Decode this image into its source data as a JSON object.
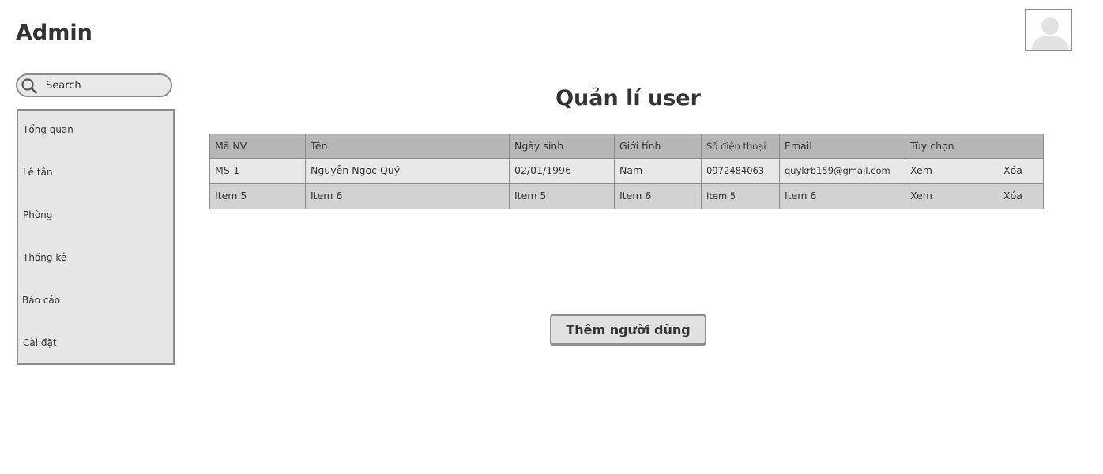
{
  "app": {
    "title": "Admin"
  },
  "search": {
    "placeholder": "Search"
  },
  "sidebar": {
    "items": [
      {
        "label": "Tổng quan"
      },
      {
        "label": "Lễ tân"
      },
      {
        "label": "Phòng"
      },
      {
        "label": "Thống kê"
      },
      {
        "label": "Báo cáo"
      },
      {
        "label": "Cài đặt"
      }
    ]
  },
  "page": {
    "title": "Quản lí user"
  },
  "table": {
    "headers": [
      "Mã NV",
      "Tên",
      "Ngày sinh",
      "Giới tính",
      "Số điện thoại",
      "Email",
      "Tùy chọn"
    ],
    "rows": [
      {
        "ma_nv": "MS-1",
        "ten": "Nguyễn Ngọc Quý",
        "ngay_sinh": "02/01/1996",
        "gioi_tinh": "Nam",
        "so_dien_thoai": "0972484063",
        "email": "quykrb159@gmail.com",
        "view": "Xem",
        "delete": "Xóa"
      },
      {
        "ma_nv": "Item 5",
        "ten": "Item 6",
        "ngay_sinh": "Item 5",
        "gioi_tinh": "Item 6",
        "so_dien_thoai": "Item 5",
        "email": "Item 6",
        "view": "Xem",
        "delete": "Xóa"
      }
    ]
  },
  "actions": {
    "add_user_label": "Thêm người dùng"
  },
  "icons": {
    "search": "search-icon",
    "avatar": "user-avatar-icon"
  },
  "colors": {
    "header_bg": "#b6b6b6",
    "row1_bg": "#e8e8e8",
    "row2_bg": "#d2d2d2",
    "sidebar_bg": "#e6e6e6",
    "border": "#8c8c8c",
    "text": "#333333"
  }
}
